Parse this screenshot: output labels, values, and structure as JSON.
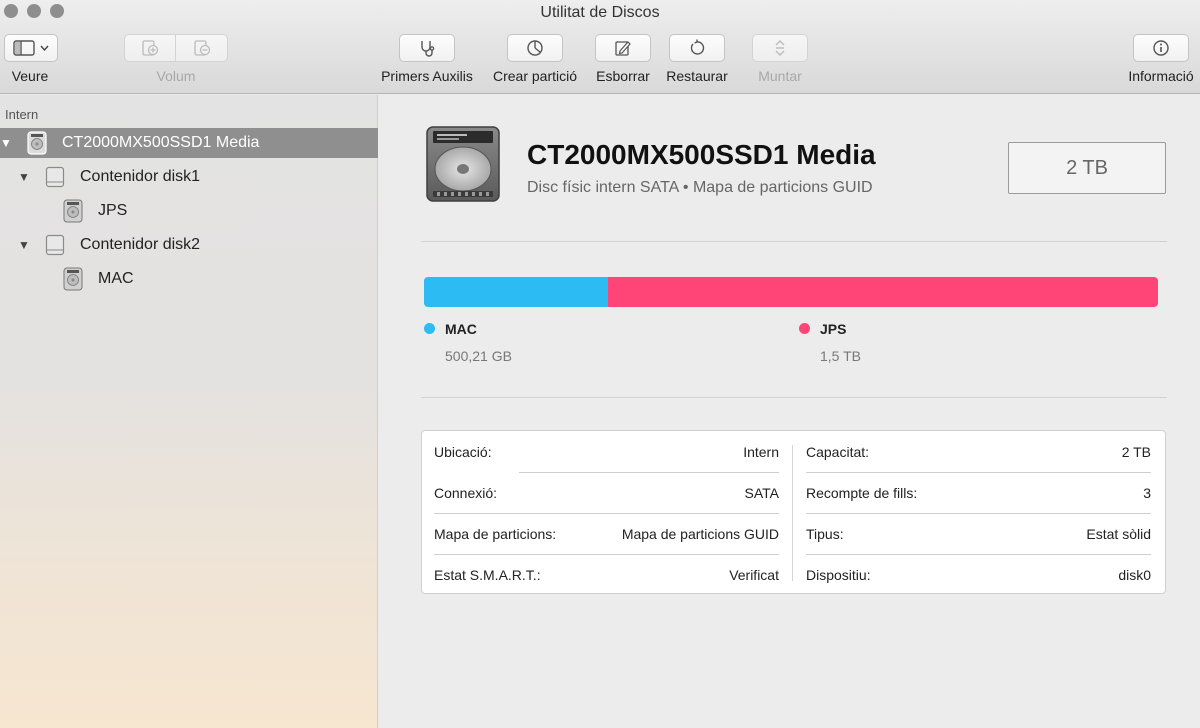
{
  "window": {
    "title": "Utilitat de Discos"
  },
  "toolbar": {
    "view_label": "Veure",
    "volume_label": "Volum",
    "first_aid_label": "Primers Auxilis",
    "partition_label": "Crear partició",
    "erase_label": "Esborrar",
    "restore_label": "Restaurar",
    "mount_label": "Muntar",
    "info_label": "Informació"
  },
  "sidebar": {
    "section": "Intern",
    "items": [
      {
        "label": "CT2000MX500SSD1 Media",
        "icon": "internal-disk-icon",
        "selected": true
      },
      {
        "label": "Contenidor disk1",
        "icon": "container-icon"
      },
      {
        "label": "JPS",
        "icon": "volume-icon"
      },
      {
        "label": "Contenidor disk2",
        "icon": "container-icon"
      },
      {
        "label": "MAC",
        "icon": "volume-icon"
      }
    ]
  },
  "main": {
    "disk_name": "CT2000MX500SSD1 Media",
    "disk_subtitle": "Disc físic intern SATA • Mapa de particions GUID",
    "capacity": "2 TB",
    "partitions": [
      {
        "name": "MAC",
        "size": "500,21 GB",
        "color": "#2cbcf3",
        "fraction": 0.25
      },
      {
        "name": "JPS",
        "size": "1,5 TB",
        "color": "#ff4577",
        "fraction": 0.75
      }
    ],
    "info": {
      "left": [
        {
          "key": "Ubicació:",
          "value": "Intern"
        },
        {
          "key": "Connexió:",
          "value": "SATA"
        },
        {
          "key": "Mapa de particions:",
          "value": "Mapa de particions GUID"
        },
        {
          "key": "Estat S.M.A.R.T.:",
          "value": "Verificat"
        }
      ],
      "right": [
        {
          "key": "Capacitat:",
          "value": "2 TB"
        },
        {
          "key": "Recompte de fills:",
          "value": "3"
        },
        {
          "key": "Tipus:",
          "value": "Estat sòlid"
        },
        {
          "key": "Dispositiu:",
          "value": "disk0"
        }
      ]
    }
  }
}
